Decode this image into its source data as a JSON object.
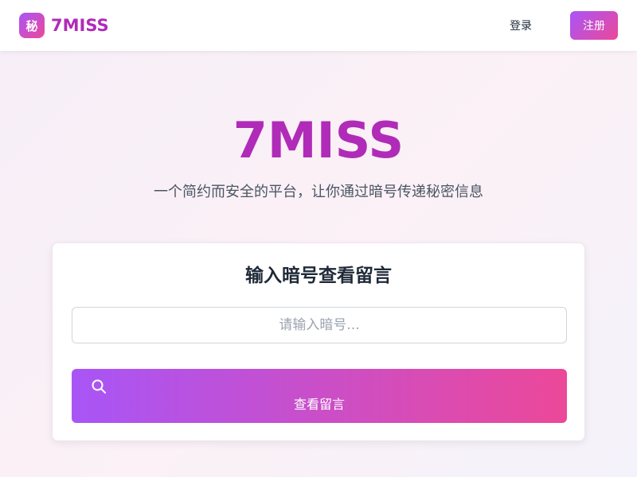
{
  "header": {
    "logo_badge": "秘",
    "brand": "7MISS",
    "login_label": "登录",
    "register_label": "注册"
  },
  "hero": {
    "title": "7MISS",
    "subtitle": "一个简约而安全的平台，让你通过暗号传递秘密信息"
  },
  "card": {
    "title": "输入暗号查看留言",
    "input_value": "",
    "input_placeholder": "请输入暗号...",
    "button_icon": "search-icon",
    "button_label": "查看留言"
  },
  "colors": {
    "brand": "#b02bb8",
    "gradient_start": "#a855f7",
    "gradient_end": "#ec4899"
  }
}
